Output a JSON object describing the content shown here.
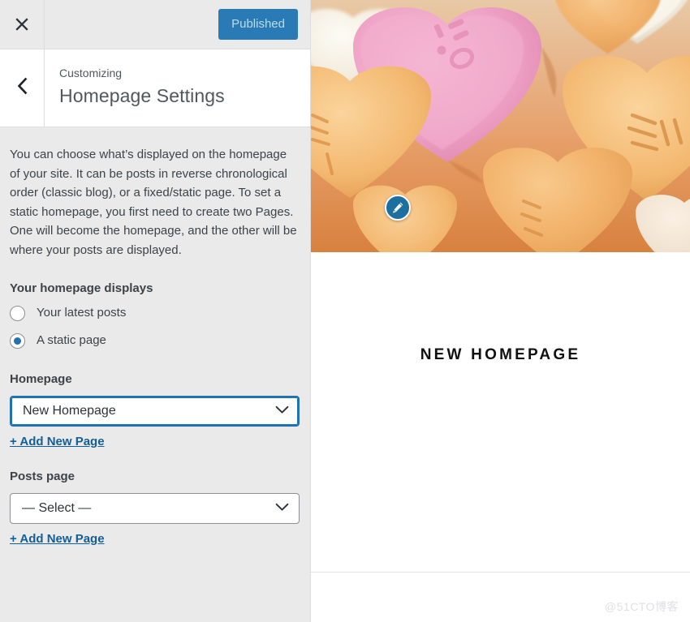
{
  "sidebar": {
    "topbar": {
      "close_icon": "close-icon",
      "publish_button_label": "Published"
    },
    "header": {
      "back_icon": "chevron-left-icon",
      "customizing_label": "Customizing",
      "panel_title": "Homepage Settings"
    },
    "description": "You can choose what’s displayed on the homepage of your site. It can be posts in reverse chronological order (classic blog), or a fixed/static page. To set a static homepage, you first need to create two Pages. One will become the homepage, and the other will be where your posts are displayed.",
    "homepage_displays": {
      "label": "Your homepage displays",
      "options": [
        {
          "label": "Your latest posts",
          "selected": false
        },
        {
          "label": "A static page",
          "selected": true
        }
      ]
    },
    "homepage_field": {
      "label": "Homepage",
      "selected_value": "New Homepage",
      "chevron_icon": "chevron-down-icon",
      "focused": true,
      "add_link_label": "+ Add New Page"
    },
    "posts_page_field": {
      "label": "Posts page",
      "selected_value": "— Select —",
      "chevron_icon": "chevron-down-icon",
      "focused": false,
      "add_link_label": "+ Add New Page"
    }
  },
  "preview": {
    "hero": {
      "alt": "close-up photo of pastel candy conversation hearts in pink, orange and white",
      "edit_icon": "pencil-edit-icon"
    },
    "page_heading": "NEW HOMEPAGE",
    "watermark": "@51CTO博客"
  },
  "colors": {
    "sidebar_bg": "#eaeaea",
    "accent_blue": "#2271b1",
    "publish_blue": "#2a7bb5",
    "link_blue": "#135e96",
    "text_dark": "#3c434a",
    "title_gray": "#50575e"
  }
}
